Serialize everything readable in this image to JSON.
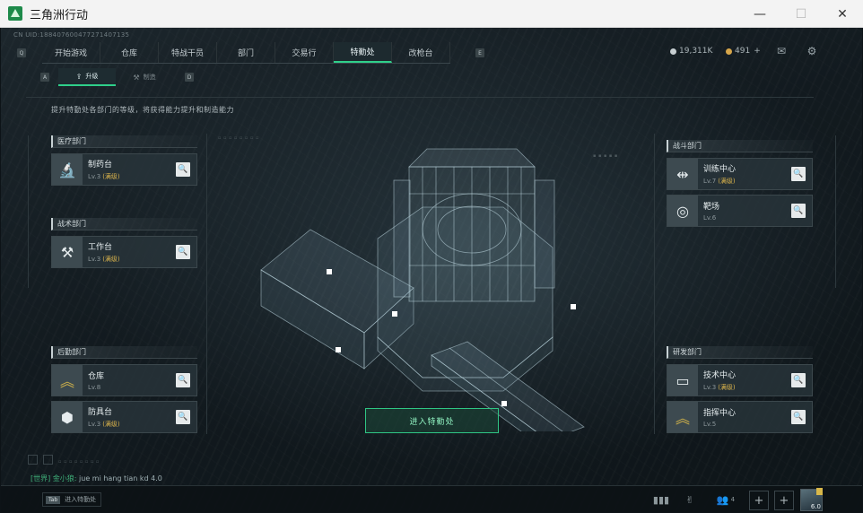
{
  "window": {
    "title": "三角洲行动",
    "minimize": "—",
    "maximize": "☐",
    "close": "✕"
  },
  "uid": "CN UID:188407600477271407135",
  "nav": {
    "prev_key": "Q",
    "next_key": "E",
    "tabs": [
      {
        "label": "开始游戏"
      },
      {
        "label": "仓库"
      },
      {
        "label": "特战干员"
      },
      {
        "label": "部门"
      },
      {
        "label": "交易行"
      },
      {
        "label": "特勤处"
      },
      {
        "label": "改枪台"
      }
    ],
    "active_index": 5
  },
  "currency": {
    "coins": "19,311K",
    "tickets": "491",
    "tickets_add": "+",
    "silver_color": "#c7ced1",
    "gold_color": "#d6a64a"
  },
  "subnav": {
    "prev_key": "A",
    "next_key": "D",
    "tabs": [
      {
        "label": "升级",
        "icon": "upgrade-icon"
      },
      {
        "label": "制造",
        "icon": "craft-icon"
      }
    ],
    "active_index": 0
  },
  "description": "提升特勤处各部门的等级，将获得能力提升和制造能力",
  "departments": {
    "medical": {
      "title": "医疗部门",
      "items": [
        {
          "name": "制药台",
          "level": "Lv.3",
          "max": "(满级)",
          "icon": "microscope-icon"
        }
      ]
    },
    "tactical": {
      "title": "战术部门",
      "items": [
        {
          "name": "工作台",
          "level": "Lv.3",
          "max": "(满级)",
          "icon": "tools-icon"
        }
      ]
    },
    "logistics": {
      "title": "后勤部门",
      "items": [
        {
          "name": "仓库",
          "level": "Lv.8",
          "max": "",
          "icon": "rank-chevron-icon"
        },
        {
          "name": "防具台",
          "level": "Lv.3",
          "max": "(满级)",
          "icon": "armor-parts-icon"
        }
      ]
    },
    "combat": {
      "title": "战斗部门",
      "items": [
        {
          "name": "训练中心",
          "level": "Lv.7",
          "max": "(满级)",
          "icon": "dumbbell-icon"
        },
        {
          "name": "靶场",
          "level": "Lv.6",
          "max": "",
          "icon": "target-icon"
        }
      ]
    },
    "research": {
      "title": "研发部门",
      "items": [
        {
          "name": "技术中心",
          "level": "Lv.3",
          "max": "(满级)",
          "icon": "computer-icon"
        },
        {
          "name": "指挥中心",
          "level": "Lv.5",
          "max": "",
          "icon": "rank-chevron-icon"
        }
      ]
    }
  },
  "enter_button": "进入特勤处",
  "chat": {
    "channel": "[世界]",
    "sender": "金小狼:",
    "message": "jue mi hang tian kd 4.0"
  },
  "bottom": {
    "hint_key": "Tab",
    "hint_label": "进入特勤处",
    "friends_count": "4",
    "avatar_level": "6.0"
  }
}
